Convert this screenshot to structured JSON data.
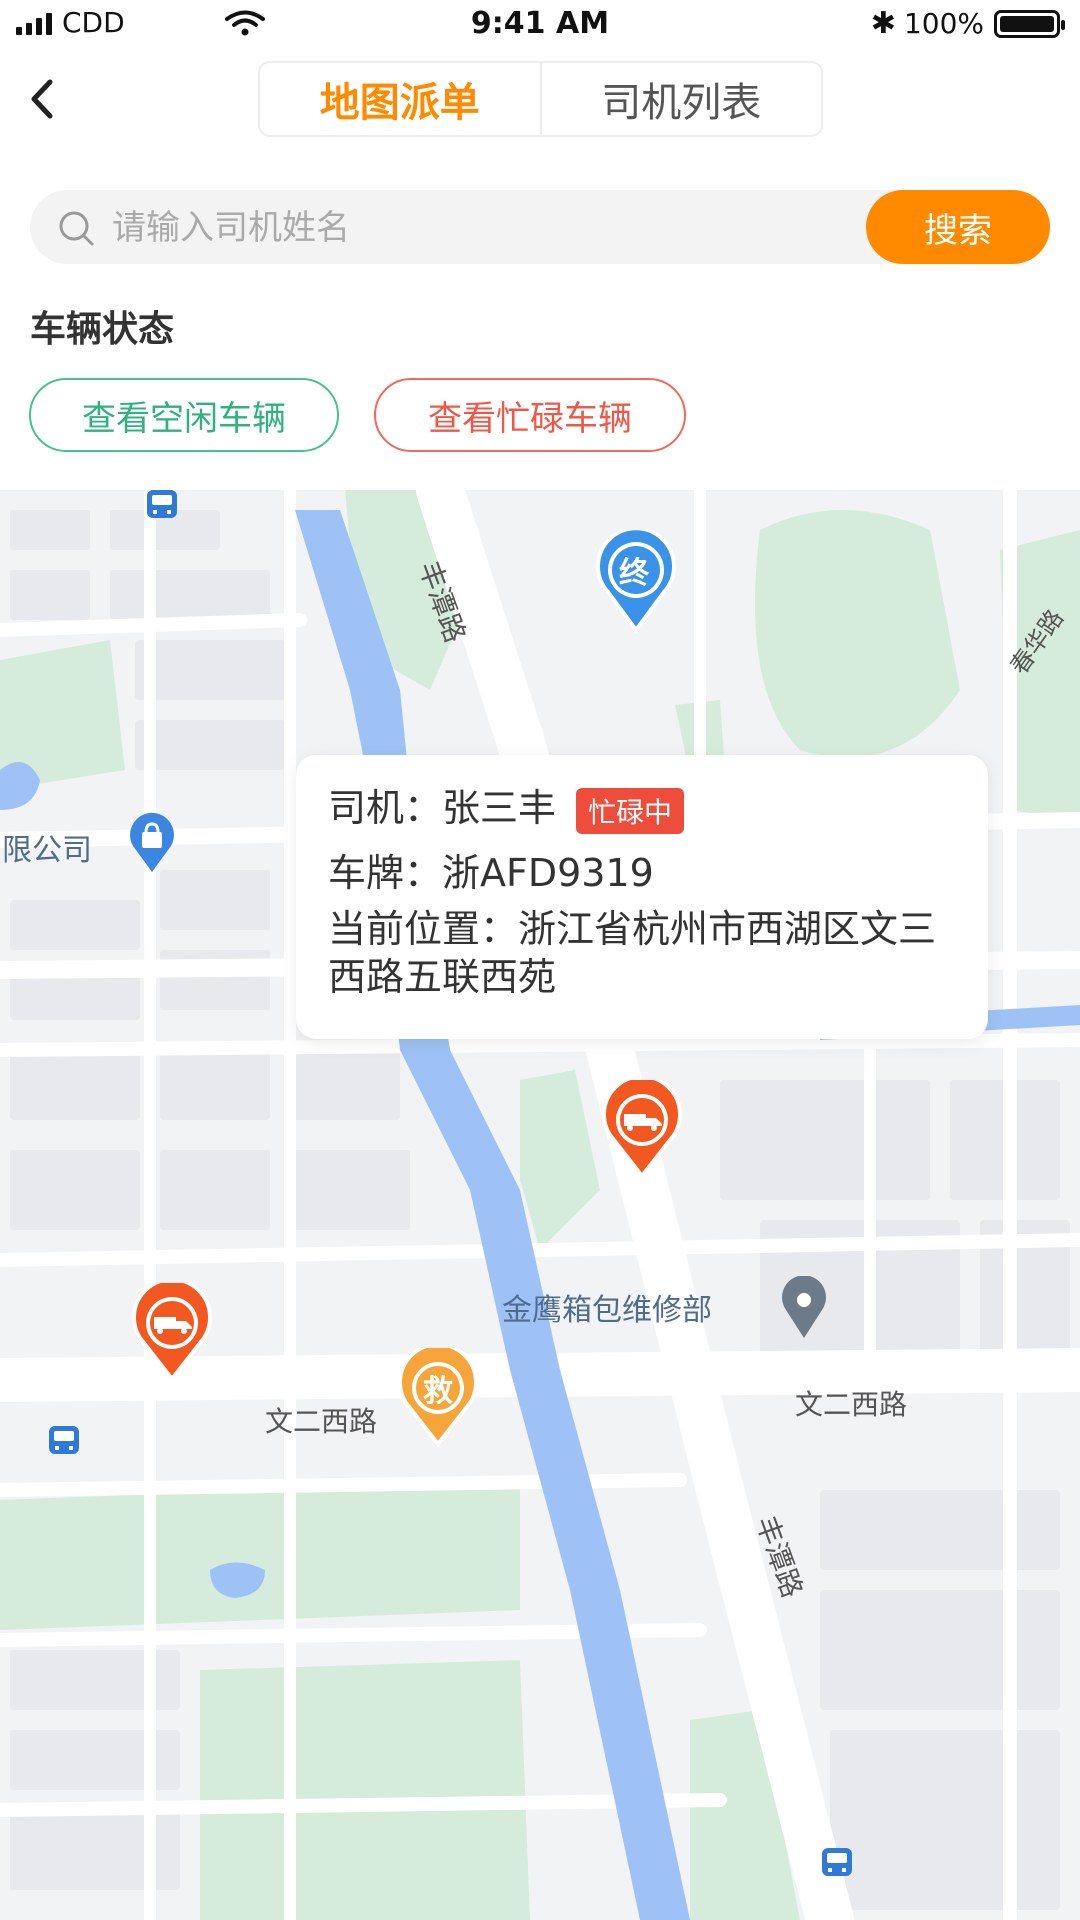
{
  "status_bar": {
    "carrier": "CDD",
    "time": "9:41 AM",
    "battery_text": "100%",
    "battery_level": 1.0
  },
  "nav": {
    "tabs": [
      {
        "label": "地图派单",
        "active": true
      },
      {
        "label": "司机列表",
        "active": false
      }
    ]
  },
  "search": {
    "placeholder": "请输入司机姓名",
    "value": "",
    "button_label": "搜索"
  },
  "vehicle_status": {
    "title": "车辆状态",
    "idle_label": "查看空闲车辆",
    "busy_label": "查看忙碌车辆"
  },
  "colors": {
    "accent": "#ff8a00",
    "idle": "#2fb27e",
    "busy": "#ef4d3c",
    "water": "#9ec2f5",
    "green": "#d5ecdc"
  },
  "map": {
    "road_labels": [
      "丰潭路",
      "春华路",
      "文二西路",
      "文二西路",
      "丰潭路"
    ],
    "poi_labels": [
      "限公司",
      "金鹰箱包维修部"
    ],
    "markers": {
      "end": "终",
      "rescue": "救"
    },
    "icons": [
      "bus-stop-icon",
      "shopping-bag-icon",
      "location-pin-icon",
      "tow-truck-icon"
    ]
  },
  "info_card": {
    "driver_label": "司机：",
    "driver_name": "张三丰",
    "status_badge": "忙碌中",
    "plate_label": "车牌：",
    "plate": "浙AFD9319",
    "location_label": "当前位置：",
    "location": "浙江省杭州市西湖区文三西路五联西苑"
  }
}
